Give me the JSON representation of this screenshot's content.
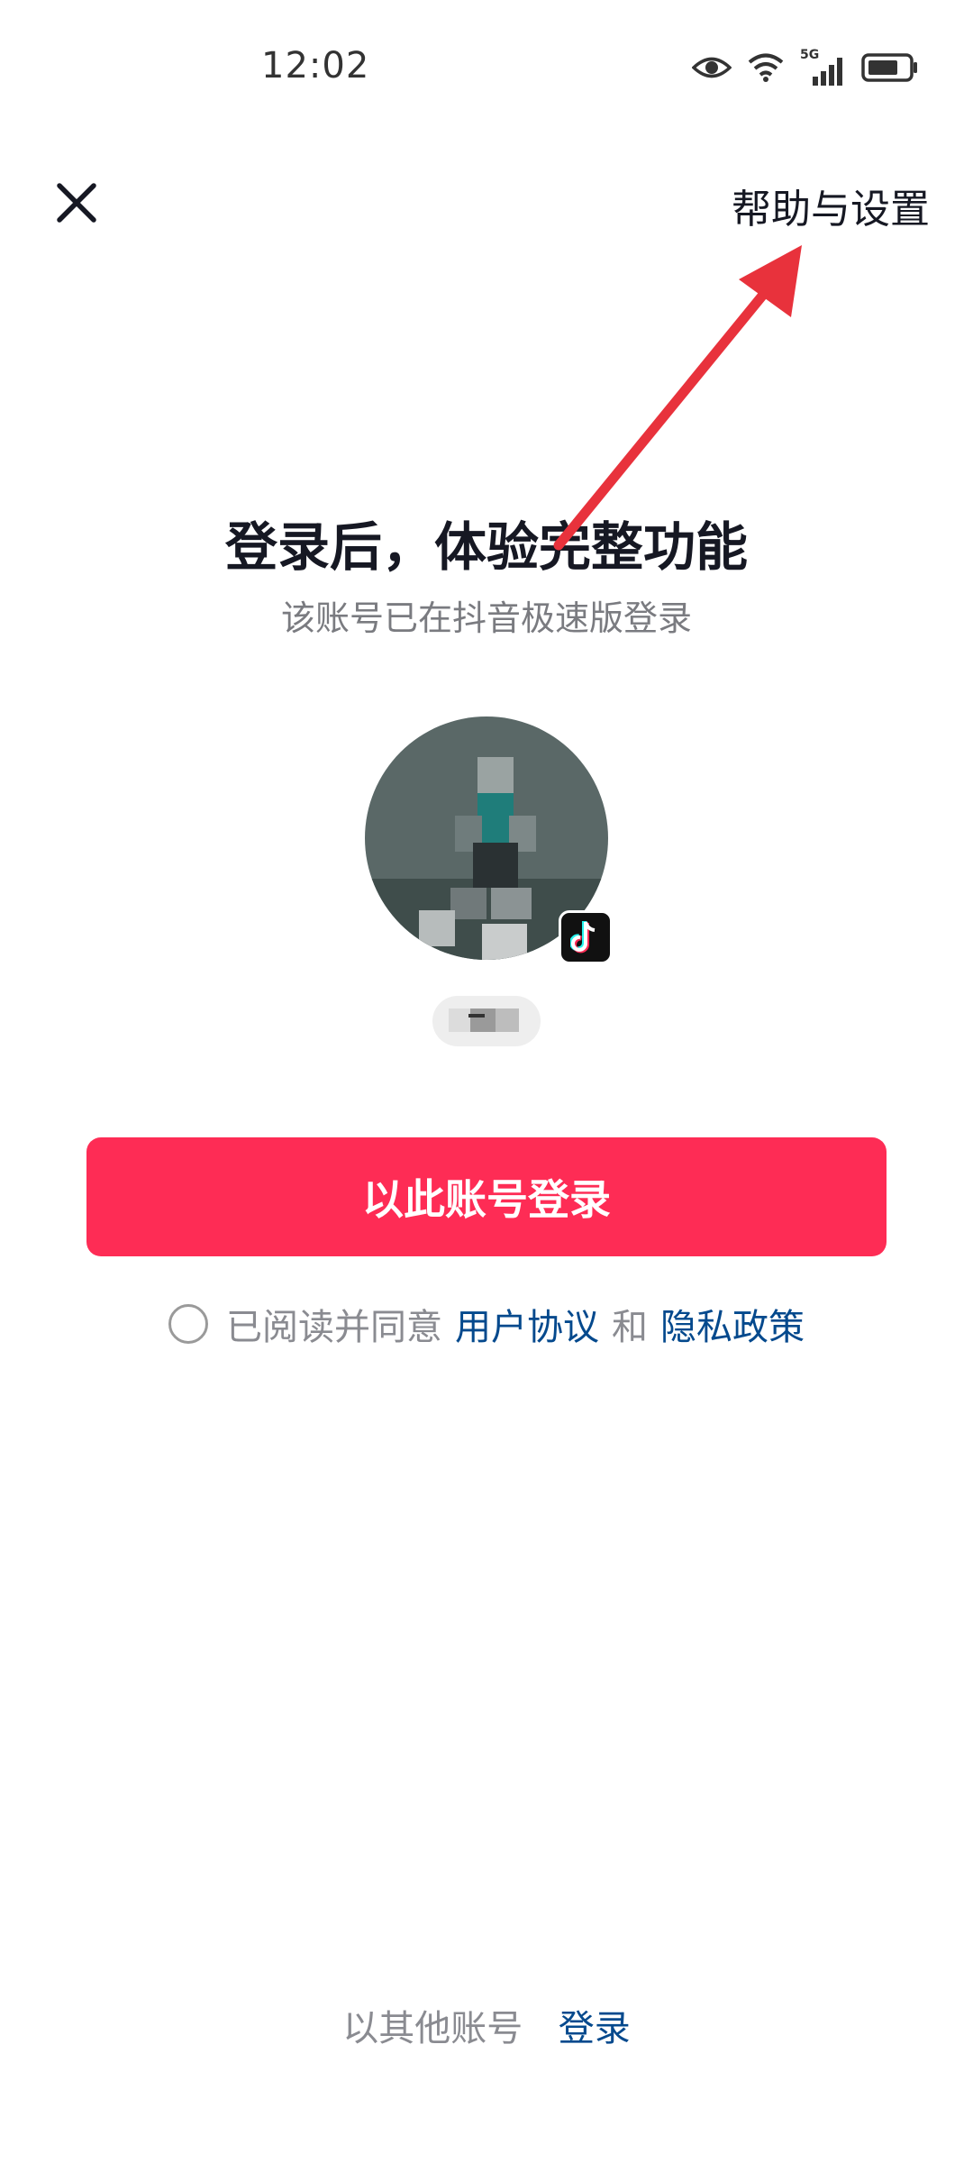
{
  "status_bar": {
    "time": "12:02",
    "icons": [
      "eye-icon",
      "wifi-icon",
      "5g-signal-icon",
      "battery-icon"
    ],
    "network_label": "5G"
  },
  "header": {
    "close_icon": "close-icon",
    "help_settings_label": "帮助与设置"
  },
  "main": {
    "title": "登录后，体验完整功能",
    "subtitle": "该账号已在抖音极速版登录",
    "avatar_badge_icon": "tiktok-icon",
    "login_button_label": "以此账号登录"
  },
  "agreement": {
    "prefix": "已阅读并同意",
    "user_agreement": "用户协议",
    "conjunction": "和",
    "privacy_policy": "隐私政策"
  },
  "footer": {
    "alt_prefix": "以其他账号",
    "alt_link": "登录"
  },
  "colors": {
    "primary": "#fe2c55",
    "link": "#04498d",
    "annotation_arrow": "#e8323c"
  }
}
